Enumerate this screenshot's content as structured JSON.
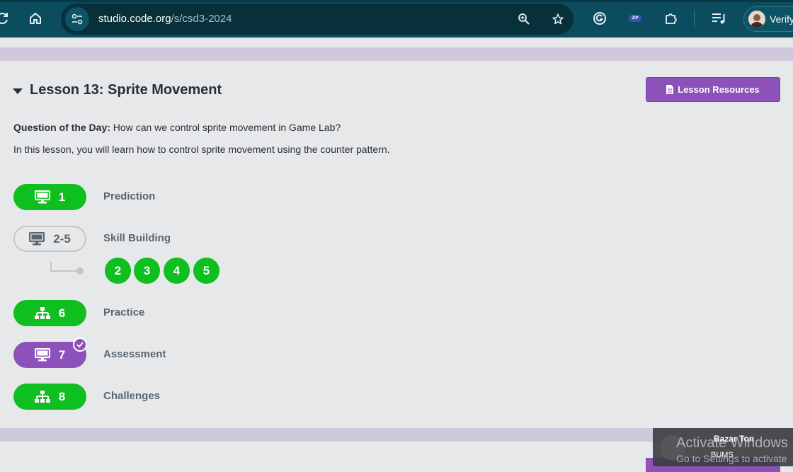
{
  "browser": {
    "url_host": "studio.code.org",
    "url_path": "/s/csd3-2024",
    "profile_label": "Verify",
    "extension_zip_label": "ZIP",
    "icons": [
      "reload-icon",
      "home-icon",
      "tune-icon",
      "zoom-icon",
      "star-icon",
      "grammarly-icon",
      "zip-extension-icon",
      "puzzle-icon",
      "media-queue-icon"
    ]
  },
  "lesson": {
    "title": "Lesson 13: Sprite Movement",
    "resources_label": "Lesson Resources",
    "qod_label": "Question of the Day:",
    "qod_text": " How can we control sprite movement in Game Lab?",
    "description": "In this lesson, you will learn how to control sprite movement using the counter pattern."
  },
  "steps": [
    {
      "num": "1",
      "label": "Prediction",
      "icon": "desktop-icon",
      "status": "complete",
      "color": "#0fbe1f"
    },
    {
      "num": "2-5",
      "label": "Skill Building",
      "icon": "desktop-icon",
      "status": "not-started",
      "color": "#c6c6c6"
    },
    {
      "num": "6",
      "label": "Practice",
      "icon": "sitemap-icon",
      "status": "complete",
      "color": "#0fbe1f"
    },
    {
      "num": "7",
      "label": "Assessment",
      "icon": "desktop-icon",
      "status": "submitted",
      "color": "#8c52ba"
    },
    {
      "num": "8",
      "label": "Challenges",
      "icon": "sitemap-icon",
      "status": "complete",
      "color": "#0fbe1f"
    }
  ],
  "sublevels": [
    "2",
    "3",
    "4",
    "5"
  ],
  "overlay": {
    "toast_title": "Bazar Ton",
    "toast_sub": "BUMS",
    "watermark_line1": "Activate Windows",
    "watermark_line2": "Go to Settings to activate"
  },
  "colors": {
    "green": "#0fbe1f",
    "purple": "#8c52ba",
    "teal": "#0b4d5e"
  }
}
